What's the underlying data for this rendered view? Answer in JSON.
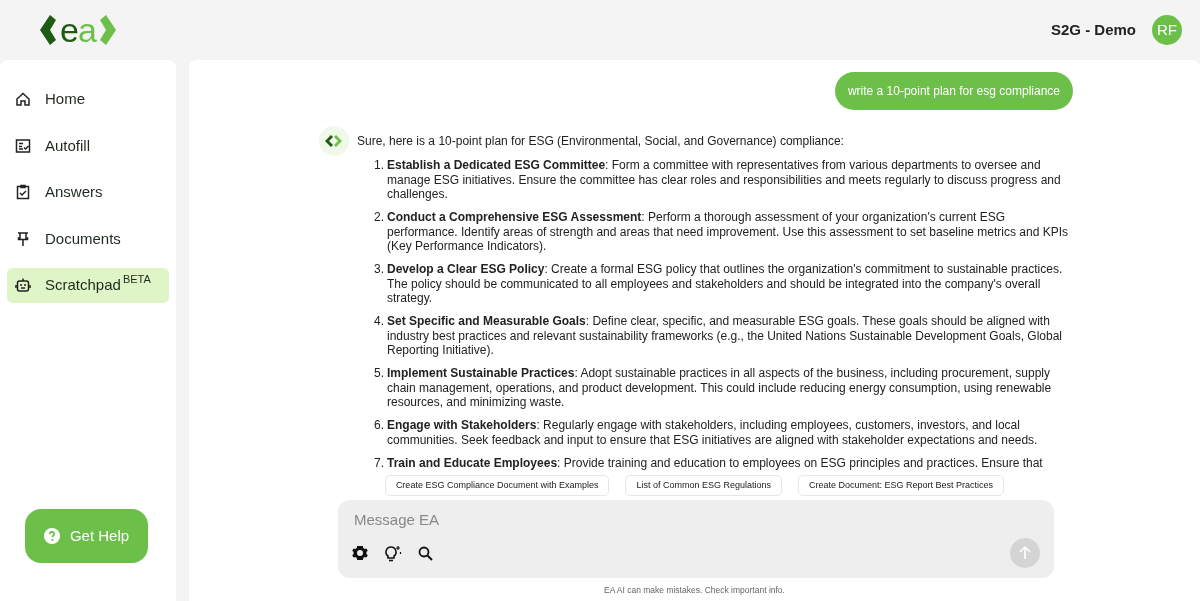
{
  "header": {
    "logo": "ea",
    "workspace": "S2G - Demo",
    "avatar": "RF"
  },
  "sidebar": {
    "items": [
      {
        "label": "Home",
        "selected": false
      },
      {
        "label": "Autofill",
        "selected": false
      },
      {
        "label": "Answers",
        "selected": false
      },
      {
        "label": "Documents",
        "selected": false
      },
      {
        "label": "Scratchpad",
        "badge": "BETA",
        "selected": true
      }
    ],
    "help_button": "Get Help"
  },
  "chat": {
    "user_message": "write a 10-point plan for esg compliance",
    "assistant_intro": "Sure, here is a 10-point plan for ESG (Environmental, Social, and Governance) compliance:",
    "plan_markers": [
      "1.",
      "2.",
      "3.",
      "4.",
      "5.",
      "6.",
      "7."
    ],
    "plan": [
      "**Establish a Dedicated ESG Committee**: Form a committee with representatives from various departments to oversee and manage ESG initiatives. Ensure the committee has clear roles and responsibilities and meets regularly to discuss progress and challenges.",
      "**Conduct a Comprehensive ESG Assessment**: Perform a thorough assessment of your organization's current ESG performance. Identify areas of strength and areas that need improvement. Use this assessment to set baseline metrics and KPIs (Key Performance Indicators).",
      "**Develop a Clear ESG Policy**: Create a formal ESG policy that outlines the organization's commitment to sustainable practices. The policy should be communicated to all employees and stakeholders and should be integrated into the company's overall strategy.",
      "**Set Specific and Measurable Goals**: Define clear, specific, and measurable ESG goals. These goals should be aligned with industry best practices and relevant sustainability frameworks (e.g., the United Nations Sustainable Development Goals, Global Reporting Initiative).",
      "**Implement Sustainable Practices**: Adopt sustainable practices in all aspects of the business, including procurement, supply chain management, operations, and product development. This could include reducing energy consumption, using renewable resources, and minimizing waste.",
      "**Engage with Stakeholders**: Regularly engage with stakeholders, including employees, customers, investors, and local communities. Seek feedback and input to ensure that ESG initiatives are aligned with stakeholder expectations and needs.",
      "**Train and Educate Employees**: Provide training and education to employees on ESG principles and practices. Ensure that"
    ]
  },
  "suggestions": [
    "Create ESG Compliance Document with Examples",
    "List of Common ESG Regulations",
    "Create Document: ESG Report Best Practices"
  ],
  "composer": {
    "placeholder": "Message EA",
    "send_disabled": true
  },
  "disclaimer": "EA AI can make mistakes. Check important info."
}
